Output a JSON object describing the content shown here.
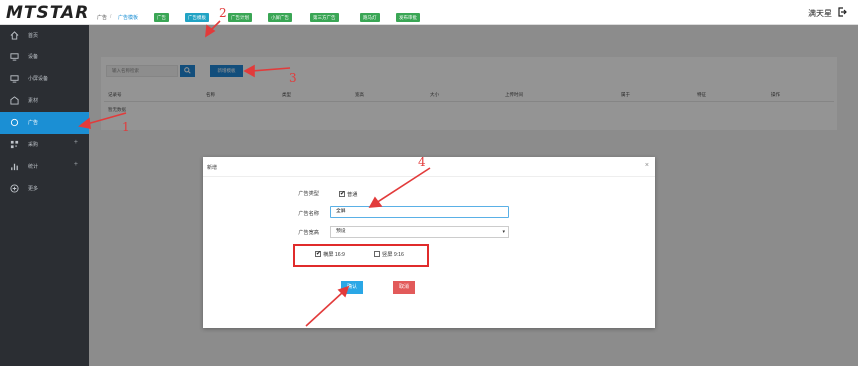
{
  "header": {
    "logo": "MTSTAR",
    "username": "满天星"
  },
  "sidebar": {
    "items": [
      {
        "label": "首页",
        "icon": "home-icon"
      },
      {
        "label": "设备",
        "icon": "device-icon"
      },
      {
        "label": "小屏设备",
        "icon": "small-screen-icon"
      },
      {
        "label": "素材",
        "icon": "material-icon"
      },
      {
        "label": "广告",
        "icon": "ad-icon",
        "active": true
      },
      {
        "label": "采购",
        "icon": "qr-icon",
        "expandable": "+"
      },
      {
        "label": "统计",
        "icon": "stats-icon",
        "expandable": "+"
      },
      {
        "label": "更多",
        "icon": "more-icon"
      }
    ]
  },
  "breadcrumb": {
    "root": "广告",
    "sep": "/",
    "current": "广告模板"
  },
  "tabs": [
    "广告",
    "广告模板",
    "广告计划",
    "小屏广告",
    "第三方广告",
    "跑马灯",
    "发布审批"
  ],
  "toolbar": {
    "search_placeholder": "输入名称检索",
    "add_label": "新增模板"
  },
  "table": {
    "columns": [
      "记录号",
      "名称",
      "类型",
      "宽高",
      "大小",
      "上传时间",
      "属于",
      "特征",
      "操作"
    ],
    "empty": "暂无数据"
  },
  "modal": {
    "title": "新增",
    "close": "×",
    "type_label": "广告类型",
    "type_option": "普通",
    "name_label": "广告名称",
    "name_value": "全屏",
    "size_label": "广告宽高",
    "size_value": "预设",
    "landscape": "横屏 16:9",
    "portrait": "竖屏 9:16",
    "ok": "确认",
    "cancel": "取消"
  },
  "annotations": [
    "1",
    "2",
    "3",
    "4"
  ],
  "colors": {
    "sidebar_bg": "#2b2e33",
    "active": "#1b8fd4",
    "tab_green": "#3aa655",
    "annotation_red": "#e23b3b"
  }
}
